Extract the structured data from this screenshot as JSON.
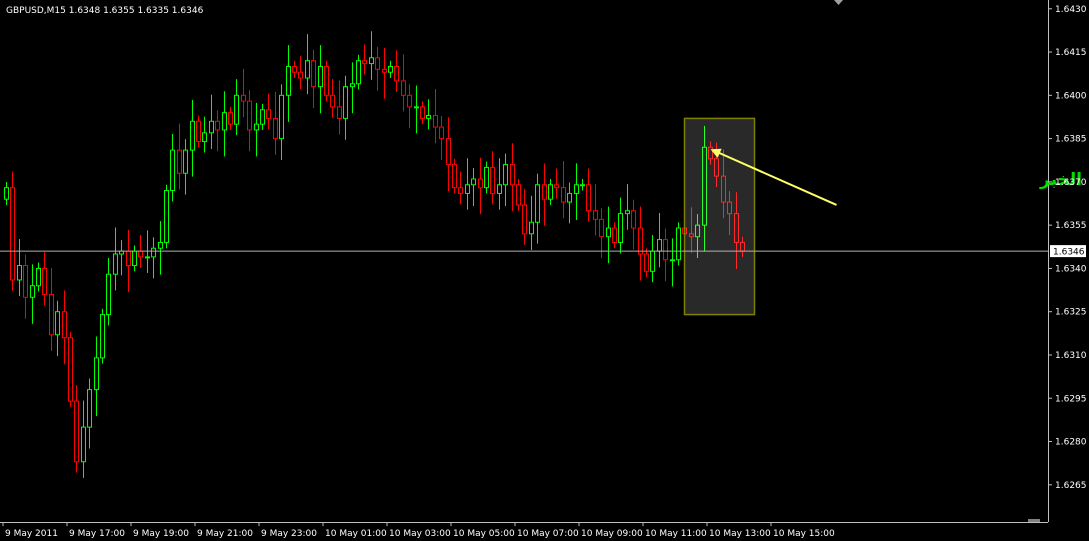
{
  "chart_data": {
    "type": "candlestick",
    "title": "GBPUSD,M15  1.6348 1.6355 1.6335 1.6346",
    "symbol": "GBPUSD,M15",
    "ohlc_header": "1.6348 1.6355 1.6335 1.6346",
    "ylim": [
      1.6258,
      1.6432
    ],
    "y_ticks": [
      "1.6430",
      "1.6415",
      "1.6400",
      "1.6385",
      "1.6370",
      "1.6355",
      "1.6340",
      "1.6325",
      "1.6310",
      "1.6295",
      "1.6280",
      "1.6265"
    ],
    "x_ticks": [
      "9 May 2011",
      "9 May 17:00",
      "9 May 19:00",
      "9 May 21:00",
      "9 May 23:00",
      "10 May 01:00",
      "10 May 03:00",
      "10 May 05:00",
      "10 May 07:00",
      "10 May 09:00",
      "10 May 11:00",
      "10 May 13:00",
      "10 May 15:00"
    ],
    "current_price": "1.6346",
    "current_price_value": 1.6346,
    "bull_color": "#00ff00",
    "bear_color": "#ff0000",
    "grid": false,
    "annotation": {
      "text": "شمعة الخبر",
      "color": "#00e000"
    },
    "highlight_color": "#808000",
    "arrow_color": "#ffff66",
    "close_series": [
      1.6368,
      1.6336,
      1.6341,
      1.633,
      1.6334,
      1.634,
      1.6331,
      1.6317,
      1.6325,
      1.6316,
      1.6294,
      1.6273,
      1.6285,
      1.6298,
      1.6309,
      1.6324,
      1.6338,
      1.6345,
      1.6346,
      1.6341,
      1.6346,
      1.6344,
      1.6344,
      1.6347,
      1.6349,
      1.6367,
      1.6381,
      1.6373,
      1.6381,
      1.6391,
      1.6384,
      1.6387,
      1.6391,
      1.6388,
      1.6394,
      1.639,
      1.64,
      1.6398,
      1.6388,
      1.639,
      1.6395,
      1.6392,
      1.6385,
      1.64,
      1.641,
      1.6408,
      1.6406,
      1.6412,
      1.6403,
      1.641,
      1.64,
      1.6396,
      1.6392,
      1.6403,
      1.6404,
      1.6412,
      1.6411,
      1.6413,
      1.6409,
      1.6408,
      1.641,
      1.6405,
      1.64,
      1.6396,
      1.6396,
      1.6392,
      1.6393,
      1.6389,
      1.6385,
      1.6376,
      1.6368,
      1.6366,
      1.6369,
      1.6371,
      1.6368,
      1.6375,
      1.6366,
      1.6369,
      1.6376,
      1.6369,
      1.6362,
      1.6352,
      1.6356,
      1.6369,
      1.6364,
      1.6369,
      1.6368,
      1.6363,
      1.6366,
      1.6369,
      1.6369,
      1.636,
      1.6357,
      1.6351,
      1.6354,
      1.6349,
      1.6359,
      1.636,
      1.6354,
      1.6345,
      1.6339,
      1.6346,
      1.635,
      1.6343,
      1.6343,
      1.6354,
      1.6352,
      1.6351,
      1.6355,
      1.6382,
      1.6378,
      1.6372,
      1.6363,
      1.6359,
      1.6349,
      1.6346
    ]
  }
}
